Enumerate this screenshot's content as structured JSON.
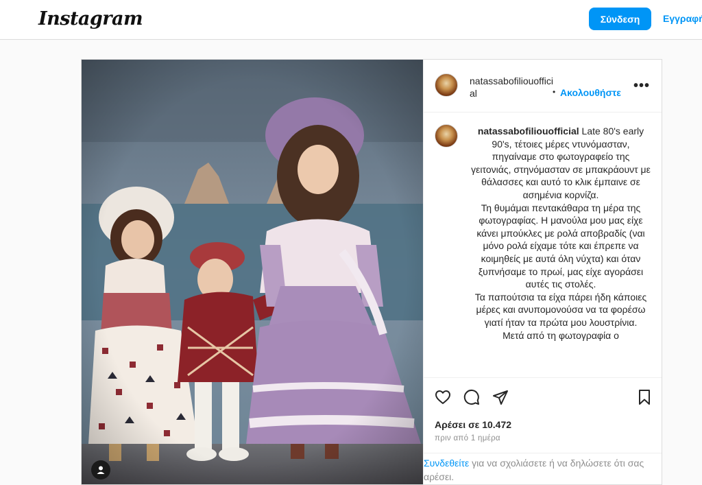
{
  "header": {
    "logo": "Instagram",
    "login_label": "Σύνδεση",
    "signup_label": "Εγγραφή"
  },
  "post": {
    "username": "natassabofiliouofficial",
    "follow_label": "Ακολουθήστε",
    "dot": "•",
    "more_label": "•••",
    "caption_lines": [
      "Late 80's early 90's, τέτοιες μέρες ντυνόμασταν, πηγαίναμε στο φωτογραφείο της γειτονιάς, στηνόμασταν σε μπακράουντ με θάλασσες και αυτό το κλικ έμπαινε σε ασημένια κορνίζα.",
      "Τη θυμάμαι πεντακάθαρα τη μέρα της φωτογραφίας. Η μανούλα μου μας είχε κάνει μπούκλες με ρολά αποβραδίς (ναι μόνο ρολά είχαμε τότε και έπρεπε να κοιμηθείς με αυτά όλη νύχτα) και όταν ξυπνήσαμε το πρωί, μας είχε αγοράσει αυτές τις στολές.",
      "Τα παπούτσια τα είχα πάρει ήδη κάποιες μέρες και ανυπομονούσα να τα φορέσω γιατί ήταν τα πρώτα μου λουστρίνια.",
      "Μετά από τη φωτογραφία ο"
    ],
    "likes": "Αρέσει σε 10.472",
    "time": "πριν από 1 ημέρα",
    "comment_link": "Συνδεθείτε",
    "comment_text": " για να σχολιάσετε ή να δηλώσετε ότι σας αρέσει."
  },
  "icons": {
    "like": "heart-icon",
    "comment": "comment-icon",
    "share": "share-icon",
    "save": "bookmark-icon",
    "tag": "user-tag-icon"
  },
  "colors": {
    "accent": "#0095f6",
    "text": "#262626",
    "muted": "#8e8e8e",
    "border": "#dbdbdb"
  }
}
